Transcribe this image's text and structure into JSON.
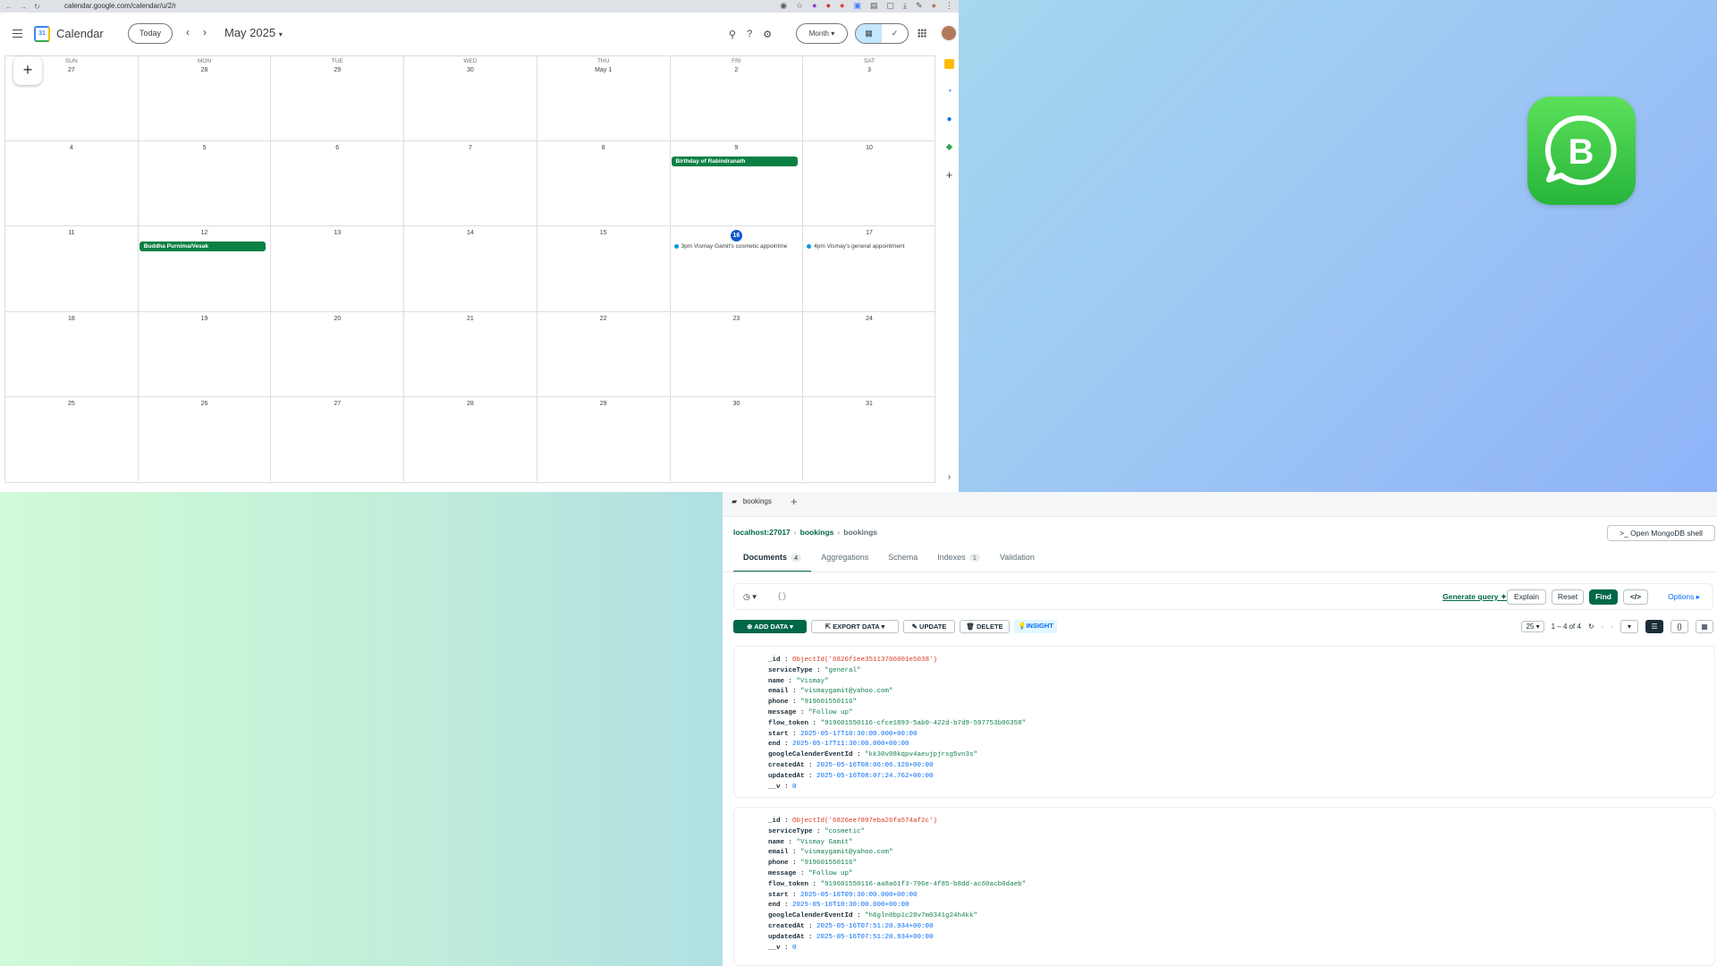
{
  "browser": {
    "url": "calendar.google.com/calendar/u/2/r"
  },
  "calendar": {
    "app_name": "Calendar",
    "logo_text": "31",
    "today_label": "Today",
    "month_label": "May 2025",
    "view_label": "Month",
    "weekdays": [
      "SUN",
      "MON",
      "TUE",
      "WED",
      "THU",
      "FRI",
      "SAT"
    ],
    "weeks": [
      [
        "27",
        "28",
        "29",
        "30",
        "May 1",
        "2",
        "3"
      ],
      [
        "4",
        "5",
        "6",
        "7",
        "8",
        "9",
        "10"
      ],
      [
        "11",
        "12",
        "13",
        "14",
        "15",
        "16",
        "17"
      ],
      [
        "18",
        "19",
        "20",
        "21",
        "22",
        "23",
        "24"
      ],
      [
        "25",
        "26",
        "27",
        "28",
        "29",
        "30",
        "31"
      ]
    ],
    "today": "16",
    "events": {
      "rabindranath": "Birthday of Rabindranath",
      "buddha": "Buddha Purnima/Vesak",
      "cosmetic": "3pm Vismay Gamit's cosmetic appointme",
      "general": "4pm Vismay's general appointment"
    },
    "colors": {
      "event_green": "#0b8043",
      "today_blue": "#0b57d0",
      "dot_blue": "#039be5"
    }
  },
  "whatsapp": {
    "logo_letter": "B"
  },
  "compass": {
    "tab_label": "bookings",
    "breadcrumb": {
      "host": "localhost:27017",
      "db": "bookings",
      "collection": "bookings"
    },
    "open_shell_label": "Open MongoDB shell",
    "tabs": [
      {
        "label": "Documents",
        "count": "4"
      },
      {
        "label": "Aggregations"
      },
      {
        "label": "Schema"
      },
      {
        "label": "Indexes",
        "count": "1"
      },
      {
        "label": "Validation"
      }
    ],
    "query": {
      "placeholder": "{}",
      "generate_label": "Generate query",
      "explain_label": "Explain",
      "reset_label": "Reset",
      "find_label": "Find",
      "options_label": "Options"
    },
    "toolbar": {
      "add_data": "ADD DATA",
      "export_data": "EXPORT DATA",
      "update": "UPDATE",
      "delete": "DELETE",
      "insight": "INSIGHT",
      "page_size": "25",
      "range": "1 – 4 of 4"
    },
    "documents": [
      {
        "id": "ObjectId('6826f1ee35113706001e5038')",
        "serviceType": "\"general\"",
        "name": "\"Vismay\"",
        "email": "\"vismaygamit@yahoo.com\"",
        "phone": "\"919601550116\"",
        "message": "\"Follow up\"",
        "flow_token": "\"919601550116-cfce1893-5ab0-422d-b7d9-597753b06358\"",
        "start": "2025-05-17T10:30:00.000+00:00",
        "end": "2025-05-17T11:30:00.000+00:00",
        "googleCalenderEventId": "\"kk30v08kqpv4aeujpjrsg5vn3s\"",
        "createdAt": "2025-05-16T08:06:06.126+00:00",
        "updatedAt": "2025-05-16T08:07:24.762+00:00",
        "v": "0"
      },
      {
        "id": "ObjectId('6826ee7897eba26fa574af2c')",
        "serviceType": "\"cosmetic\"",
        "name": "\"Vismay Gamit\"",
        "email": "\"vismaygamit@yahoo.com\"",
        "phone": "\"919601550116\"",
        "message": "\"Follow up\"",
        "flow_token": "\"919601550116-aa8a61f3-796e-4f85-b8dd-ac60acb0daeb\"",
        "start": "2025-05-16T09:30:00.000+00:00",
        "end": "2025-05-16T10:30:00.000+00:00",
        "googleCalenderEventId": "\"h6gln0bp1c28v7m0341g24h4kk\"",
        "createdAt": "2025-05-16T07:51:20.934+00:00",
        "updatedAt": "2025-05-16T07:51:20.934+00:00",
        "v": "0"
      }
    ],
    "field_labels": {
      "id": "_id",
      "serviceType": "serviceType",
      "name": "name",
      "email": "email",
      "phone": "phone",
      "message": "message",
      "flow_token": "flow_token",
      "start": "start",
      "end": "end",
      "googleCalenderEventId": "googleCalenderEventId",
      "createdAt": "createdAt",
      "updatedAt": "updatedAt",
      "v": "__v"
    },
    "colors": {
      "brand_green": "#00684a",
      "link_blue": "#016bf8",
      "oid_red": "#db3b22"
    }
  }
}
